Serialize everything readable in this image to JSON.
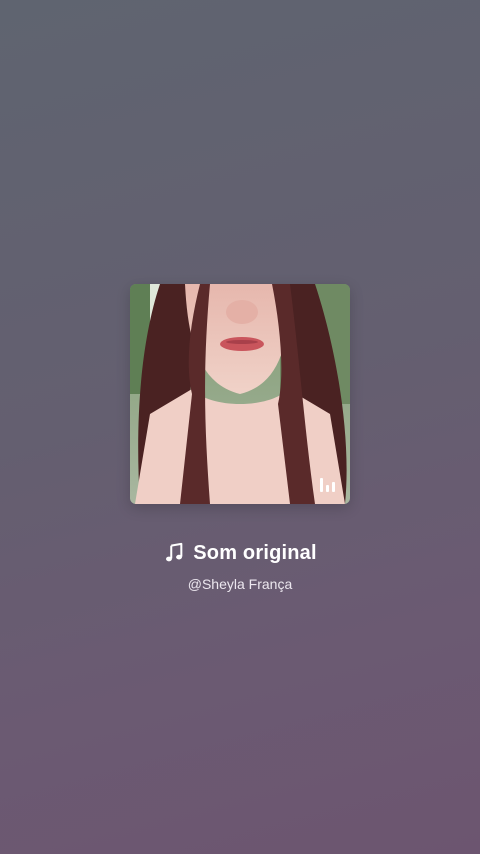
{
  "sound": {
    "title": "Som original",
    "author": "@Sheyla França",
    "note_icon": "music-note-icon",
    "playing_icon": "equalizer-bars-icon"
  },
  "colors": {
    "background_top": "#5f6470",
    "background_bottom": "#6c5570",
    "text": "#ffffff"
  }
}
